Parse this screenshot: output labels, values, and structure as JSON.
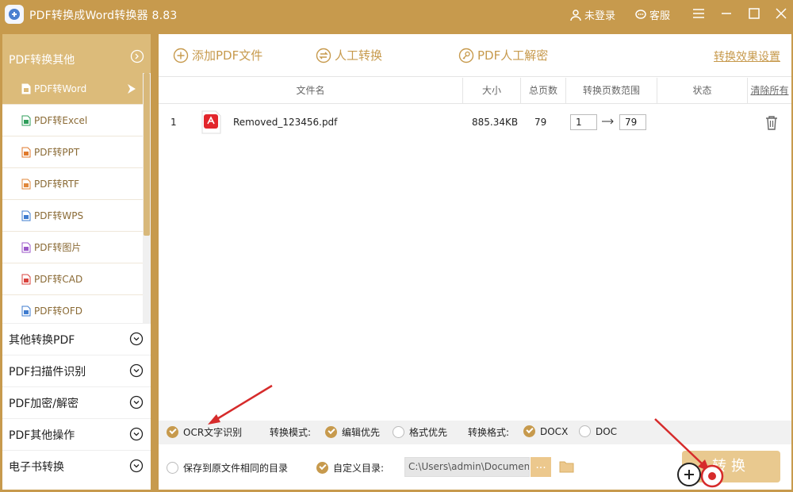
{
  "app": {
    "title": "PDF转换成Word转换器 8.83",
    "login": "未登录",
    "service": "客服"
  },
  "sidebar": {
    "active_group": "PDF转换其他",
    "items": [
      {
        "label": "PDF转Word",
        "icon": "word-file-icon",
        "color": "#4a7fd0"
      },
      {
        "label": "PDF转Excel",
        "icon": "excel-file-icon",
        "color": "#2f9e5a"
      },
      {
        "label": "PDF转PPT",
        "icon": "ppt-file-icon",
        "color": "#e07a2c"
      },
      {
        "label": "PDF转RTF",
        "icon": "rtf-file-icon",
        "color": "#e0873a"
      },
      {
        "label": "PDF转WPS",
        "icon": "wps-file-icon",
        "color": "#3f7ccf"
      },
      {
        "label": "PDF转图片",
        "icon": "image-file-icon",
        "color": "#9b57c9"
      },
      {
        "label": "PDF转CAD",
        "icon": "cad-file-icon",
        "color": "#d9433d"
      },
      {
        "label": "PDF转OFD",
        "icon": "ofd-file-icon",
        "color": "#3f7ccf"
      }
    ],
    "groups": [
      "其他转换PDF",
      "PDF扫描件识别",
      "PDF加密/解密",
      "PDF其他操作",
      "电子书转换"
    ]
  },
  "toolbar": {
    "add_file": "添加PDF文件",
    "manual_convert": "人工转换",
    "manual_decrypt": "PDF人工解密",
    "settings": "转换效果设置"
  },
  "table": {
    "headers": {
      "filename": "文件名",
      "size": "大小",
      "pages": "总页数",
      "range": "转换页数范围",
      "status": "状态",
      "clear": "清除所有"
    },
    "rows": [
      {
        "index": "1",
        "filename": "Removed_123456.pdf",
        "size": "885.34KB",
        "pages": "79",
        "from": "1",
        "to": "79",
        "status": ""
      }
    ]
  },
  "options": {
    "ocr": "OCR文字识别",
    "mode_label": "转换模式:",
    "mode_edit": "编辑优先",
    "mode_format": "格式优先",
    "format_label": "转换格式:",
    "fmt_docx": "DOCX",
    "fmt_doc": "DOC",
    "ocr_checked": true,
    "mode": "编辑优先",
    "format": "DOCX"
  },
  "bottom": {
    "same_dir": "保存到原文件相同的目录",
    "custom_dir": "自定义目录:",
    "path": "C:\\Users\\admin\\Documents",
    "browse": "...",
    "convert": "转换",
    "custom_checked": true
  },
  "colors": {
    "accent": "#c79a4d",
    "accent_light": "#dcbb7a",
    "arrow": "#d62b2b"
  }
}
